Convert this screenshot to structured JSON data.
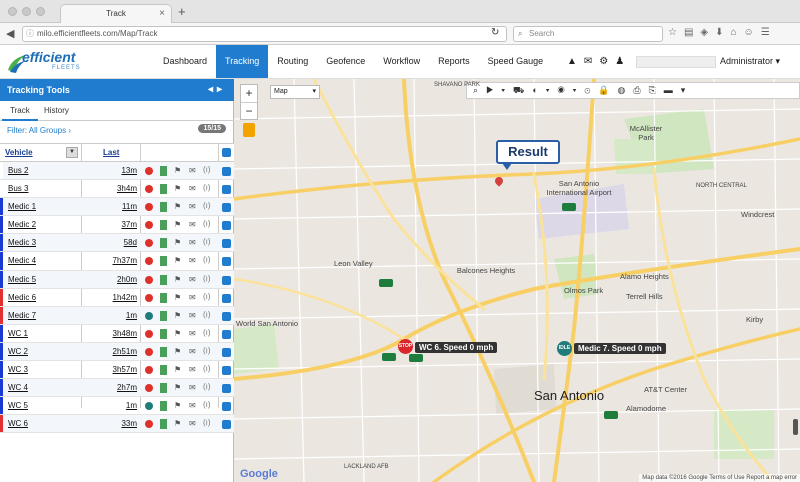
{
  "browser": {
    "tab_title": "Track",
    "url": "milo.efficientfleets.com/Map/Track",
    "search_placeholder": "Search"
  },
  "app": {
    "logo_text": "efficient",
    "logo_sub": "FLEETS",
    "nav": [
      {
        "label": "Dashboard"
      },
      {
        "label": "Tracking"
      },
      {
        "label": "Routing"
      },
      {
        "label": "Geofence"
      },
      {
        "label": "Workflow"
      },
      {
        "label": "Reports"
      },
      {
        "label": "Speed Gauge"
      }
    ],
    "active_nav": "Tracking",
    "user_label": "Administrator"
  },
  "panel": {
    "title": "Tracking Tools",
    "tabs": [
      "Track",
      "History"
    ],
    "filter_label": "Filter: All Groups",
    "count": "15/15",
    "col_vehicle": "Vehicle",
    "col_last": "Last",
    "rows": [
      {
        "name": "Bus 2",
        "last": "13m",
        "stripe": "#ffffff",
        "status": "red"
      },
      {
        "name": "Bus 3",
        "last": "3h4m",
        "stripe": "#ffffff",
        "status": "red"
      },
      {
        "name": "Medic 1",
        "last": "11m",
        "stripe": "#1a3ad4",
        "status": "red"
      },
      {
        "name": "Medic 2",
        "last": "37m",
        "stripe": "#1a3ad4",
        "status": "red"
      },
      {
        "name": "Medic 3",
        "last": "58d",
        "stripe": "#1a3ad4",
        "status": "red"
      },
      {
        "name": "Medic 4",
        "last": "7h37m",
        "stripe": "#1a3ad4",
        "status": "red"
      },
      {
        "name": "Medic 5",
        "last": "2h0m",
        "stripe": "#1a3ad4",
        "status": "red"
      },
      {
        "name": "Medic 6",
        "last": "1h42m",
        "stripe": "#e23030",
        "status": "red"
      },
      {
        "name": "Medic 7",
        "last": "1m",
        "stripe": "#e23030",
        "status": "teal"
      },
      {
        "name": "WC 1",
        "last": "3h48m",
        "stripe": "#1a3ad4",
        "status": "red"
      },
      {
        "name": "WC 2",
        "last": "2h51m",
        "stripe": "#1a3ad4",
        "status": "red"
      },
      {
        "name": "WC 3",
        "last": "3h57m",
        "stripe": "#1a3ad4",
        "status": "red"
      },
      {
        "name": "WC 4",
        "last": "2h7m",
        "stripe": "#1a3ad4",
        "status": "red"
      },
      {
        "name": "WC 5",
        "last": "1m",
        "stripe": "#1a3ad4",
        "status": "teal"
      },
      {
        "name": "WC 6",
        "last": "33m",
        "stripe": "#e23030",
        "status": "red"
      }
    ]
  },
  "map": {
    "map_type": "Map",
    "result_label": "Result",
    "vehicle_labels": [
      {
        "text": "WC 6. Speed 0 mph",
        "marker_text": "STOP",
        "marker_color": "#d8262b"
      },
      {
        "text": "Medic 7. Speed 0 mph",
        "marker_text": "IDLE",
        "marker_color": "#1e7d7a"
      }
    ],
    "places": [
      "Leon Valley",
      "Balcones Heights",
      "San Antonio International Airport",
      "Olmos Park",
      "Alamo Heights",
      "Terrell Hills",
      "McAllister Park",
      "Windcrest",
      "Kirby",
      "AT&T Center",
      "Alamodome",
      "San Antonio",
      "World San Antonio",
      "SHAVANO PARK",
      "NORTH CENTRAL",
      "LACKLAND AFB"
    ],
    "attribution": "Map data ©2016 Google   Terms of Use   Report a map error",
    "provider": "Google"
  }
}
